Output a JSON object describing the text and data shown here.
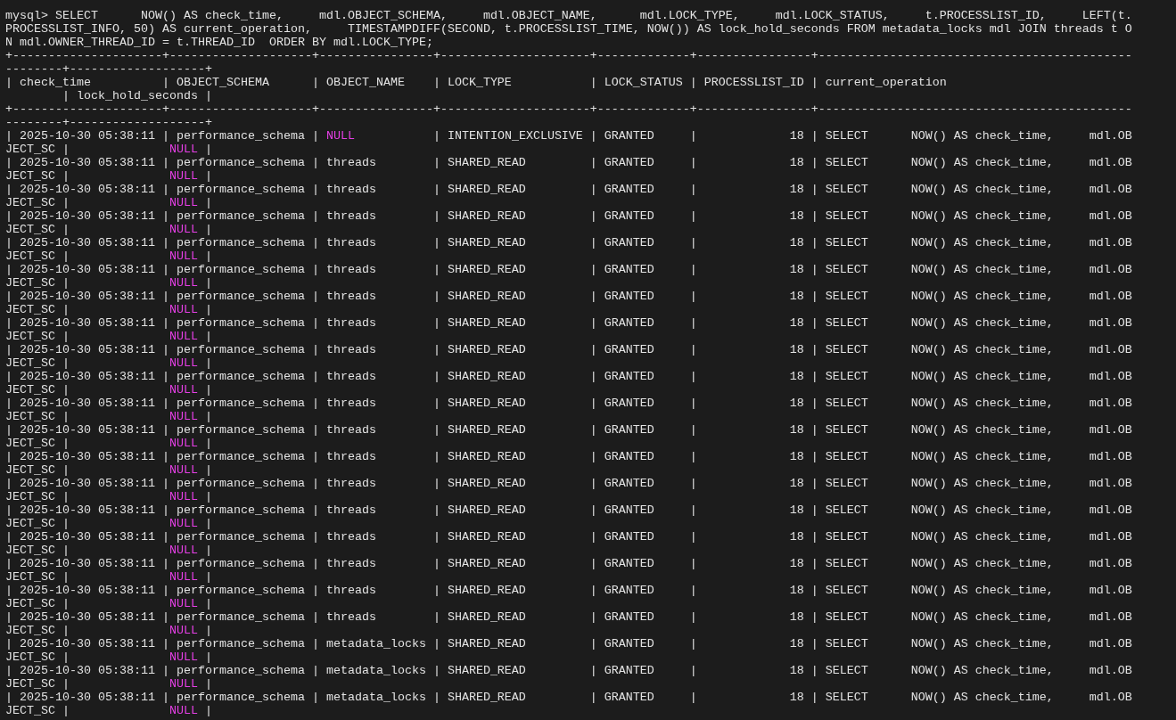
{
  "terminal": {
    "lines": [
      [
        {
          "text": "mysql> SELECT      NOW() AS check_time,     mdl.OBJECT_SCHEMA,     mdl.OBJECT_NAME,      mdl.LOCK_TYPE,     mdl.LOCK_STATUS,     t.PROCESSLIST_ID,     LEFT(t.",
          "is_null": false
        }
      ],
      [
        {
          "text": "PROCESSLIST_INFO, 50) AS current_operation,     TIMESTAMPDIFF(SECOND, t.PROCESSLIST_TIME, NOW()) AS lock_hold_seconds FROM metadata_locks mdl JOIN threads t O",
          "is_null": false
        }
      ],
      [
        {
          "text": "N mdl.OWNER_THREAD_ID = t.THREAD_ID  ORDER BY mdl.LOCK_TYPE;",
          "is_null": false
        }
      ],
      [
        {
          "text": "+---------------------+--------------------+----------------+---------------------+-------------+----------------+--------------------------------------------",
          "is_null": false
        }
      ],
      [
        {
          "text": "--------+-------------------+",
          "is_null": false
        }
      ],
      [
        {
          "text": "| check_time          | OBJECT_SCHEMA      | OBJECT_NAME    | LOCK_TYPE           | LOCK_STATUS | PROCESSLIST_ID | current_operation",
          "is_null": false
        }
      ],
      [
        {
          "text": "        | lock_hold_seconds |",
          "is_null": false
        }
      ],
      [
        {
          "text": "+---------------------+--------------------+----------------+---------------------+-------------+----------------+--------------------------------------------",
          "is_null": false
        }
      ],
      [
        {
          "text": "--------+-------------------+",
          "is_null": false
        }
      ],
      [
        {
          "text": "| 2025-10-30 05:38:11 | performance_schema | ",
          "is_null": false
        },
        {
          "text": "NULL",
          "is_null": true
        },
        {
          "text": "           | INTENTION_EXCLUSIVE | GRANTED     |             18 | SELECT      NOW() AS check_time,     mdl.OB",
          "is_null": false
        }
      ],
      [
        {
          "text": "JECT_SC |              ",
          "is_null": false
        },
        {
          "text": "NULL",
          "is_null": true
        },
        {
          "text": " |",
          "is_null": false
        }
      ],
      [
        {
          "text": "| 2025-10-30 05:38:11 | performance_schema | threads        | SHARED_READ         | GRANTED     |             18 | SELECT      NOW() AS check_time,     mdl.OB",
          "is_null": false
        }
      ],
      [
        {
          "text": "JECT_SC |              ",
          "is_null": false
        },
        {
          "text": "NULL",
          "is_null": true
        },
        {
          "text": " |",
          "is_null": false
        }
      ],
      [
        {
          "text": "| 2025-10-30 05:38:11 | performance_schema | threads        | SHARED_READ         | GRANTED     |             18 | SELECT      NOW() AS check_time,     mdl.OB",
          "is_null": false
        }
      ],
      [
        {
          "text": "JECT_SC |              ",
          "is_null": false
        },
        {
          "text": "NULL",
          "is_null": true
        },
        {
          "text": " |",
          "is_null": false
        }
      ],
      [
        {
          "text": "| 2025-10-30 05:38:11 | performance_schema | threads        | SHARED_READ         | GRANTED     |             18 | SELECT      NOW() AS check_time,     mdl.OB",
          "is_null": false
        }
      ],
      [
        {
          "text": "JECT_SC |              ",
          "is_null": false
        },
        {
          "text": "NULL",
          "is_null": true
        },
        {
          "text": " |",
          "is_null": false
        }
      ],
      [
        {
          "text": "| 2025-10-30 05:38:11 | performance_schema | threads        | SHARED_READ         | GRANTED     |             18 | SELECT      NOW() AS check_time,     mdl.OB",
          "is_null": false
        }
      ],
      [
        {
          "text": "JECT_SC |              ",
          "is_null": false
        },
        {
          "text": "NULL",
          "is_null": true
        },
        {
          "text": " |",
          "is_null": false
        }
      ],
      [
        {
          "text": "| 2025-10-30 05:38:11 | performance_schema | threads        | SHARED_READ         | GRANTED     |             18 | SELECT      NOW() AS check_time,     mdl.OB",
          "is_null": false
        }
      ],
      [
        {
          "text": "JECT_SC |              ",
          "is_null": false
        },
        {
          "text": "NULL",
          "is_null": true
        },
        {
          "text": " |",
          "is_null": false
        }
      ],
      [
        {
          "text": "| 2025-10-30 05:38:11 | performance_schema | threads        | SHARED_READ         | GRANTED     |             18 | SELECT      NOW() AS check_time,     mdl.OB",
          "is_null": false
        }
      ],
      [
        {
          "text": "JECT_SC |              ",
          "is_null": false
        },
        {
          "text": "NULL",
          "is_null": true
        },
        {
          "text": " |",
          "is_null": false
        }
      ],
      [
        {
          "text": "| 2025-10-30 05:38:11 | performance_schema | threads        | SHARED_READ         | GRANTED     |             18 | SELECT      NOW() AS check_time,     mdl.OB",
          "is_null": false
        }
      ],
      [
        {
          "text": "JECT_SC |              ",
          "is_null": false
        },
        {
          "text": "NULL",
          "is_null": true
        },
        {
          "text": " |",
          "is_null": false
        }
      ],
      [
        {
          "text": "| 2025-10-30 05:38:11 | performance_schema | threads        | SHARED_READ         | GRANTED     |             18 | SELECT      NOW() AS check_time,     mdl.OB",
          "is_null": false
        }
      ],
      [
        {
          "text": "JECT_SC |              ",
          "is_null": false
        },
        {
          "text": "NULL",
          "is_null": true
        },
        {
          "text": " |",
          "is_null": false
        }
      ],
      [
        {
          "text": "| 2025-10-30 05:38:11 | performance_schema | threads        | SHARED_READ         | GRANTED     |             18 | SELECT      NOW() AS check_time,     mdl.OB",
          "is_null": false
        }
      ],
      [
        {
          "text": "JECT_SC |              ",
          "is_null": false
        },
        {
          "text": "NULL",
          "is_null": true
        },
        {
          "text": " |",
          "is_null": false
        }
      ],
      [
        {
          "text": "| 2025-10-30 05:38:11 | performance_schema | threads        | SHARED_READ         | GRANTED     |             18 | SELECT      NOW() AS check_time,     mdl.OB",
          "is_null": false
        }
      ],
      [
        {
          "text": "JECT_SC |              ",
          "is_null": false
        },
        {
          "text": "NULL",
          "is_null": true
        },
        {
          "text": " |",
          "is_null": false
        }
      ],
      [
        {
          "text": "| 2025-10-30 05:38:11 | performance_schema | threads        | SHARED_READ         | GRANTED     |             18 | SELECT      NOW() AS check_time,     mdl.OB",
          "is_null": false
        }
      ],
      [
        {
          "text": "JECT_SC |              ",
          "is_null": false
        },
        {
          "text": "NULL",
          "is_null": true
        },
        {
          "text": " |",
          "is_null": false
        }
      ],
      [
        {
          "text": "| 2025-10-30 05:38:11 | performance_schema | threads        | SHARED_READ         | GRANTED     |             18 | SELECT      NOW() AS check_time,     mdl.OB",
          "is_null": false
        }
      ],
      [
        {
          "text": "JECT_SC |              ",
          "is_null": false
        },
        {
          "text": "NULL",
          "is_null": true
        },
        {
          "text": " |",
          "is_null": false
        }
      ],
      [
        {
          "text": "| 2025-10-30 05:38:11 | performance_schema | threads        | SHARED_READ         | GRANTED     |             18 | SELECT      NOW() AS check_time,     mdl.OB",
          "is_null": false
        }
      ],
      [
        {
          "text": "JECT_SC |              ",
          "is_null": false
        },
        {
          "text": "NULL",
          "is_null": true
        },
        {
          "text": " |",
          "is_null": false
        }
      ],
      [
        {
          "text": "| 2025-10-30 05:38:11 | performance_schema | threads        | SHARED_READ         | GRANTED     |             18 | SELECT      NOW() AS check_time,     mdl.OB",
          "is_null": false
        }
      ],
      [
        {
          "text": "JECT_SC |              ",
          "is_null": false
        },
        {
          "text": "NULL",
          "is_null": true
        },
        {
          "text": " |",
          "is_null": false
        }
      ],
      [
        {
          "text": "| 2025-10-30 05:38:11 | performance_schema | threads        | SHARED_READ         | GRANTED     |             18 | SELECT      NOW() AS check_time,     mdl.OB",
          "is_null": false
        }
      ],
      [
        {
          "text": "JECT_SC |              ",
          "is_null": false
        },
        {
          "text": "NULL",
          "is_null": true
        },
        {
          "text": " |",
          "is_null": false
        }
      ],
      [
        {
          "text": "| 2025-10-30 05:38:11 | performance_schema | threads        | SHARED_READ         | GRANTED     |             18 | SELECT      NOW() AS check_time,     mdl.OB",
          "is_null": false
        }
      ],
      [
        {
          "text": "JECT_SC |              ",
          "is_null": false
        },
        {
          "text": "NULL",
          "is_null": true
        },
        {
          "text": " |",
          "is_null": false
        }
      ],
      [
        {
          "text": "| 2025-10-30 05:38:11 | performance_schema | threads        | SHARED_READ         | GRANTED     |             18 | SELECT      NOW() AS check_time,     mdl.OB",
          "is_null": false
        }
      ],
      [
        {
          "text": "JECT_SC |              ",
          "is_null": false
        },
        {
          "text": "NULL",
          "is_null": true
        },
        {
          "text": " |",
          "is_null": false
        }
      ],
      [
        {
          "text": "| 2025-10-30 05:38:11 | performance_schema | threads        | SHARED_READ         | GRANTED     |             18 | SELECT      NOW() AS check_time,     mdl.OB",
          "is_null": false
        }
      ],
      [
        {
          "text": "JECT_SC |              ",
          "is_null": false
        },
        {
          "text": "NULL",
          "is_null": true
        },
        {
          "text": " |",
          "is_null": false
        }
      ],
      [
        {
          "text": "| 2025-10-30 05:38:11 | performance_schema | metadata_locks | SHARED_READ         | GRANTED     |             18 | SELECT      NOW() AS check_time,     mdl.OB",
          "is_null": false
        }
      ],
      [
        {
          "text": "JECT_SC |              ",
          "is_null": false
        },
        {
          "text": "NULL",
          "is_null": true
        },
        {
          "text": " |",
          "is_null": false
        }
      ],
      [
        {
          "text": "| 2025-10-30 05:38:11 | performance_schema | metadata_locks | SHARED_READ         | GRANTED     |             18 | SELECT      NOW() AS check_time,     mdl.OB",
          "is_null": false
        }
      ],
      [
        {
          "text": "JECT_SC |              ",
          "is_null": false
        },
        {
          "text": "NULL",
          "is_null": true
        },
        {
          "text": " |",
          "is_null": false
        }
      ],
      [
        {
          "text": "| 2025-10-30 05:38:11 | performance_schema | metadata_locks | SHARED_READ         | GRANTED     |             18 | SELECT      NOW() AS check_time,     mdl.OB",
          "is_null": false
        }
      ],
      [
        {
          "text": "JECT_SC |              ",
          "is_null": false
        },
        {
          "text": "NULL",
          "is_null": true
        },
        {
          "text": " |",
          "is_null": false
        }
      ]
    ]
  }
}
